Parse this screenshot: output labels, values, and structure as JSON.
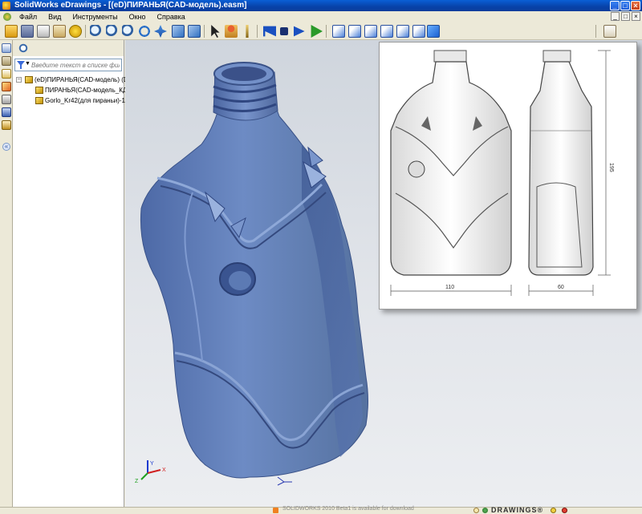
{
  "window": {
    "title": "SolidWorks eDrawings - [(eD)ПИРАНЬЯ(CAD-модель).easm]",
    "min_label": "_",
    "max_label": "□",
    "close_label": "×"
  },
  "menu": {
    "items": [
      "Файл",
      "Вид",
      "Инструменты",
      "Окно",
      "Справка"
    ],
    "doc_controls": [
      "_",
      "□",
      "×"
    ]
  },
  "toolbar": {
    "icons": [
      "open-icon",
      "save-icon",
      "print-icon",
      "mail-icon",
      "help-icon",
      "zoom-fit-icon",
      "zoom-area-icon",
      "zoom-icon",
      "rotate-icon",
      "pan-icon",
      "view-cube-icon",
      "shaded-icon",
      "select-arrow-icon",
      "walkthrough-icon",
      "measure-icon",
      "first-frame-icon",
      "stop-icon",
      "next-frame-icon",
      "play-icon",
      "front-view-icon",
      "back-view-icon",
      "left-view-icon",
      "right-view-icon",
      "top-view-icon",
      "bottom-view-icon",
      "isometric-view-icon",
      "markup-icon"
    ]
  },
  "tree": {
    "filter_placeholder": "Введите текст в списке фильтра",
    "filter_dropdown": "▼",
    "collapse_symbol": "−",
    "nodes": [
      {
        "label": "(eD)ПИРАНЬЯ(CAD-модель) (Def",
        "level": 0
      },
      {
        "label": "ПИРАНЬЯ(CAD-модель_КД)",
        "level": 1
      },
      {
        "label": "Gorlo_Kr42(для пираньи)-1",
        "level": 1
      }
    ]
  },
  "left_pane": {
    "expand_symbol": "«"
  },
  "drawing": {
    "dims": {
      "width": "110",
      "depth": "60",
      "height": "195"
    }
  },
  "axes": {
    "x": "X",
    "y": "Y",
    "z": "Z"
  },
  "status": {
    "message": "SOLIDWORKS 2010 Beta1 is available for download",
    "brand": "DRAWINGS®"
  },
  "colors": {
    "model": "#6a88c0",
    "model_shadow": "#3c5690",
    "titlebar": "#0842a8",
    "viewport_bg": "#d8dde4"
  }
}
